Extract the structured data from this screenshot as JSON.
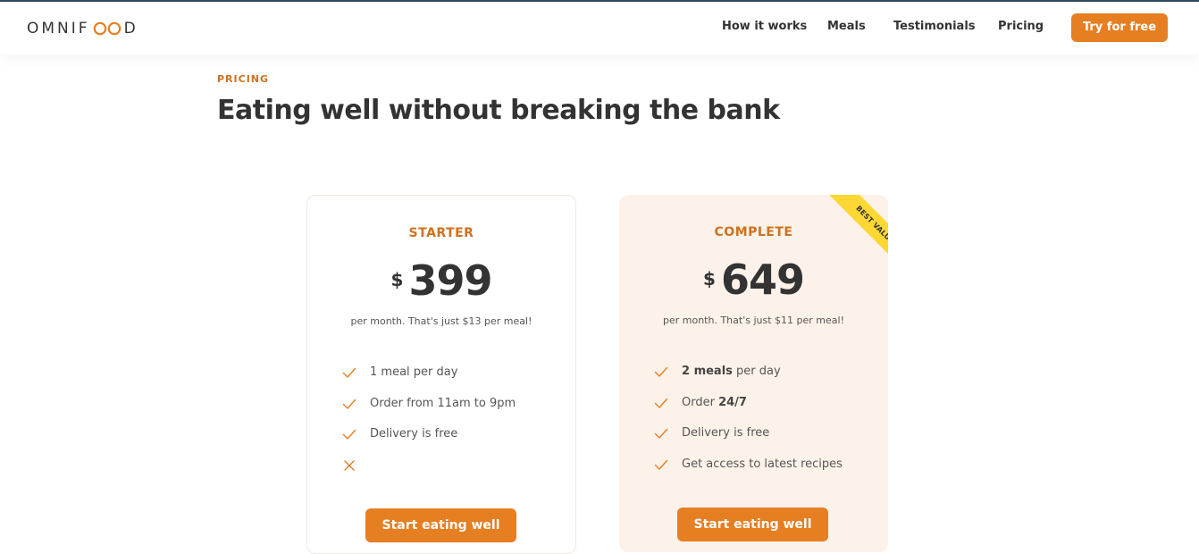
{
  "header": {
    "logo_text_left": "OMNIF",
    "logo_text_right": "D",
    "nav": [
      {
        "label": "How it works"
      },
      {
        "label": "Meals"
      },
      {
        "label": "Testimonials"
      },
      {
        "label": "Pricing"
      }
    ],
    "cta_label": "Try for free"
  },
  "section": {
    "subheading": "PRICING",
    "heading": "Eating well without breaking the bank"
  },
  "plans": [
    {
      "name": "STARTER",
      "currency": "$",
      "price": "399",
      "note": "per month. That's just $13 per meal!",
      "features": [
        {
          "icon": "check-icon",
          "text": "1 meal per day"
        },
        {
          "icon": "check-icon",
          "text": "Order from 11am to 9pm"
        },
        {
          "icon": "check-icon",
          "text": "Delivery is free"
        },
        {
          "icon": "close-icon",
          "text": ""
        }
      ],
      "button_label": "Start eating well"
    },
    {
      "name": "COMPLETE",
      "currency": "$",
      "price": "649",
      "note": "per month. That's just $11 per meal!",
      "ribbon": "BEST VALUE",
      "features": [
        {
          "icon": "check-icon",
          "bold": "2 meals",
          "rest": " per day"
        },
        {
          "icon": "check-icon",
          "pre": "Order ",
          "bold": "24/7"
        },
        {
          "icon": "check-icon",
          "text": "Delivery is free"
        },
        {
          "icon": "check-icon",
          "text": "Get access to latest recipes"
        }
      ],
      "button_label": "Start eating well"
    }
  ],
  "colors": {
    "accent": "#e67e22",
    "accent_text": "#cf711f",
    "complete_bg": "#fdf2e9",
    "ribbon": "#fdd835"
  }
}
